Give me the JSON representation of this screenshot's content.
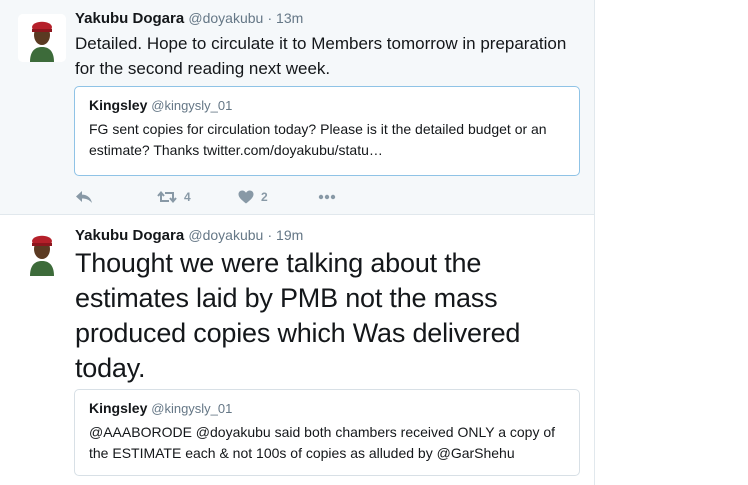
{
  "tweets": [
    {
      "author": {
        "name": "Yakubu Dogara",
        "handle": "@doyakubu"
      },
      "time": "· 13m",
      "text": "Detailed. Hope to circulate it to Members tomorrow in preparation for the second reading next week.",
      "quote": {
        "author": {
          "name": "Kingsley",
          "handle": "@kingysly_01"
        },
        "text": "FG sent copies for circulation today? Please is it the detailed budget or an estimate? Thanks twitter.com/doyakubu/statu…"
      },
      "actions": {
        "retweets": "4",
        "likes": "2"
      }
    },
    {
      "author": {
        "name": "Yakubu Dogara",
        "handle": "@doyakubu"
      },
      "time": "· 19m",
      "text": "Thought we were talking about the estimates laid by PMB not the mass produced copies which Was delivered today.",
      "quote": {
        "author": {
          "name": "Kingsley",
          "handle": "@kingysly_01"
        },
        "text": "@AAABORODE @doyakubu said both chambers received ONLY a copy of the ESTIMATE each & not 100s of copies as alluded by @GarShehu"
      }
    }
  ],
  "icons": {
    "reply": "reply-icon",
    "retweet": "retweet-icon",
    "like": "heart-icon",
    "more": "more-dots-icon"
  },
  "colors": {
    "muted": "#657786",
    "action": "#8899a6",
    "selected_quote_border": "#8fc3e6",
    "tweet_bg_hover": "#f5f8fa"
  }
}
